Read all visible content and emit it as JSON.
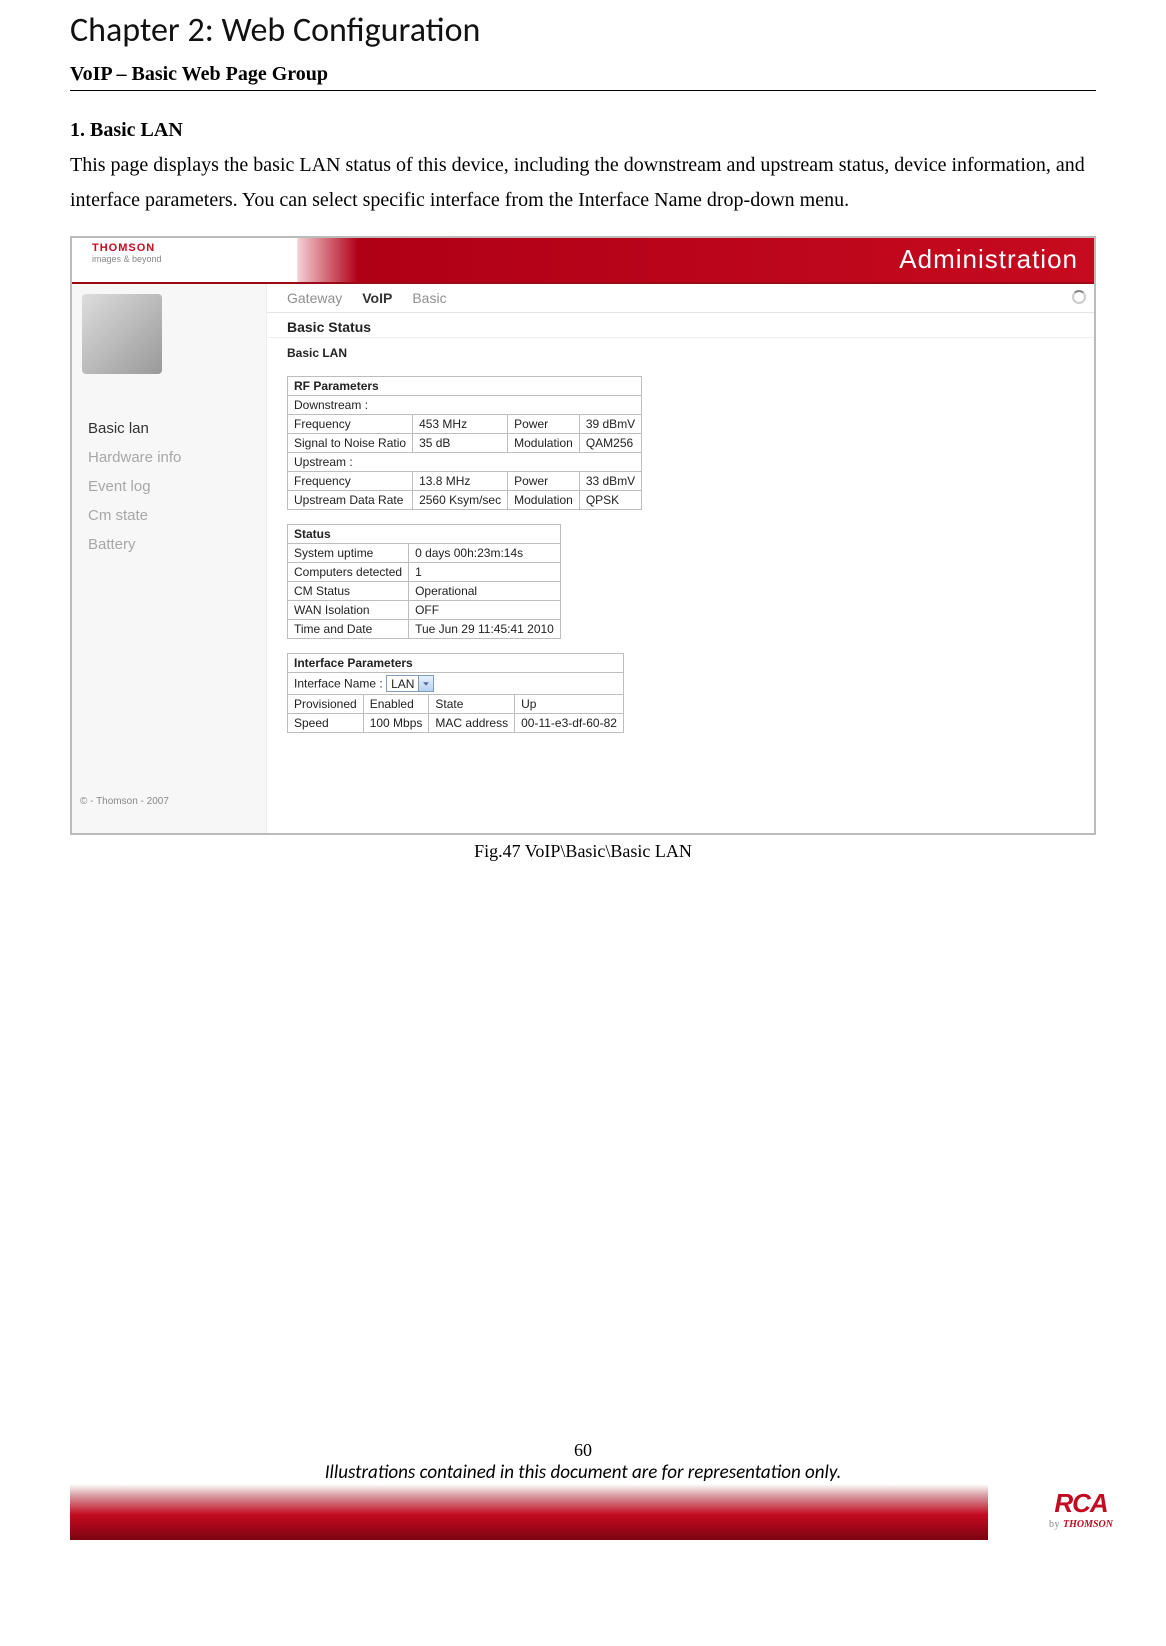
{
  "chapter_title": "Chapter 2: Web Configuration",
  "section_group": "VoIP – Basic Web Page Group",
  "subsection": "1. Basic LAN",
  "paragraph": "This page displays the basic LAN status of this device, including the downstream and upstream status, device information, and interface parameters. You can select specific interface from the Interface Name drop-down menu.",
  "figure_caption": "Fig.47 VoIP\\Basic\\Basic LAN",
  "page_number": "60",
  "disclaimer": "Illustrations contained in this document are for representation only.",
  "footer_logo": {
    "brand": "RCA",
    "byline_prefix": "by ",
    "byline_brand": "THOMSON"
  },
  "screenshot": {
    "logo": {
      "name": "THOMSON",
      "tagline": "images & beyond"
    },
    "banner_right": "Administration",
    "tabs": {
      "gateway": "Gateway",
      "voip": "VoIP",
      "basic": "Basic"
    },
    "page_title": "Basic Status",
    "page_subtitle": "Basic LAN",
    "sidebar": {
      "items": [
        "Basic lan",
        "Hardware info",
        "Event log",
        "Cm state",
        "Battery"
      ],
      "copyright": "© - Thomson - 2007"
    },
    "rf": {
      "header": "RF Parameters",
      "down_label": "Downstream :",
      "d_freq_l": "Frequency",
      "d_freq_v": "453 MHz",
      "d_pow_l": "Power",
      "d_pow_v": "39 dBmV",
      "snr_l": "Signal to Noise Ratio",
      "snr_v": "35 dB",
      "mod_l": "Modulation",
      "d_mod_v": "QAM256",
      "up_label": "Upstream :",
      "u_freq_l": "Frequency",
      "u_freq_v": "13.8 MHz",
      "u_pow_l": "Power",
      "u_pow_v": "33 dBmV",
      "udr_l": "Upstream Data Rate",
      "udr_v": "2560 Ksym/sec",
      "u_mod_v": "QPSK"
    },
    "status": {
      "header": "Status",
      "uptime_l": "System uptime",
      "uptime_v": "0 days 00h:23m:14s",
      "comp_l": "Computers detected",
      "comp_v": "1",
      "cm_l": "CM Status",
      "cm_v": "Operational",
      "wan_l": "WAN Isolation",
      "wan_v": "OFF",
      "td_l": "Time and Date",
      "td_v": "Tue Jun 29 11:45:41 2010"
    },
    "iface": {
      "header": "Interface Parameters",
      "name_l": "Interface Name :",
      "select_value": "LAN",
      "prov_l": "Provisioned",
      "prov_v": "Enabled",
      "state_l": "State",
      "state_v": "Up",
      "speed_l": "Speed",
      "speed_v": "100 Mbps",
      "mac_l": "MAC address",
      "mac_v": "00-11-e3-df-60-82"
    }
  }
}
